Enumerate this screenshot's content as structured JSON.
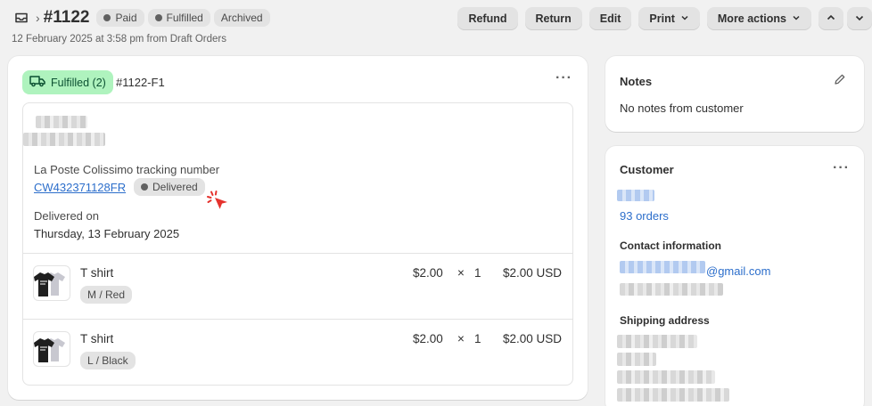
{
  "header": {
    "order_number": "#1122",
    "badges": [
      "Paid",
      "Fulfilled",
      "Archived"
    ],
    "subtitle": "12 February 2025 at 3:58 pm from Draft Orders",
    "actions": {
      "refund": "Refund",
      "return": "Return",
      "edit": "Edit",
      "print": "Print",
      "more": "More actions"
    }
  },
  "fulfillment": {
    "badge": "Fulfilled (2)",
    "id": "#1122-F1",
    "tracking_label": "La Poste Colissimo tracking number",
    "tracking_number": "CW432371128FR",
    "tracking_status": "Delivered",
    "delivered_on_label": "Delivered on",
    "delivered_on_value": "Thursday, 13 February 2025",
    "items": [
      {
        "name": "T shirt",
        "variant": "M / Red",
        "price": "$2.00",
        "times": "×",
        "qty": "1",
        "total": "$2.00 USD"
      },
      {
        "name": "T shirt",
        "variant": "L / Black",
        "price": "$2.00",
        "times": "×",
        "qty": "1",
        "total": "$2.00 USD"
      }
    ]
  },
  "notes": {
    "title": "Notes",
    "text": "No notes from customer"
  },
  "customer": {
    "title": "Customer",
    "orders": "93 orders",
    "contact_label": "Contact information",
    "email_suffix": "@gmail.com",
    "shipping_label": "Shipping address"
  },
  "colors": {
    "accent_link": "#2c6ecb",
    "fulfilled_badge_bg": "#aff3be",
    "fulfilled_badge_text": "#0c5132",
    "cursor": "#e5322d"
  },
  "icons": [
    "inbox-icon",
    "truck-icon",
    "pencil-icon",
    "chevron-up-icon",
    "chevron-down-icon",
    "pointer-cursor-icon"
  ]
}
